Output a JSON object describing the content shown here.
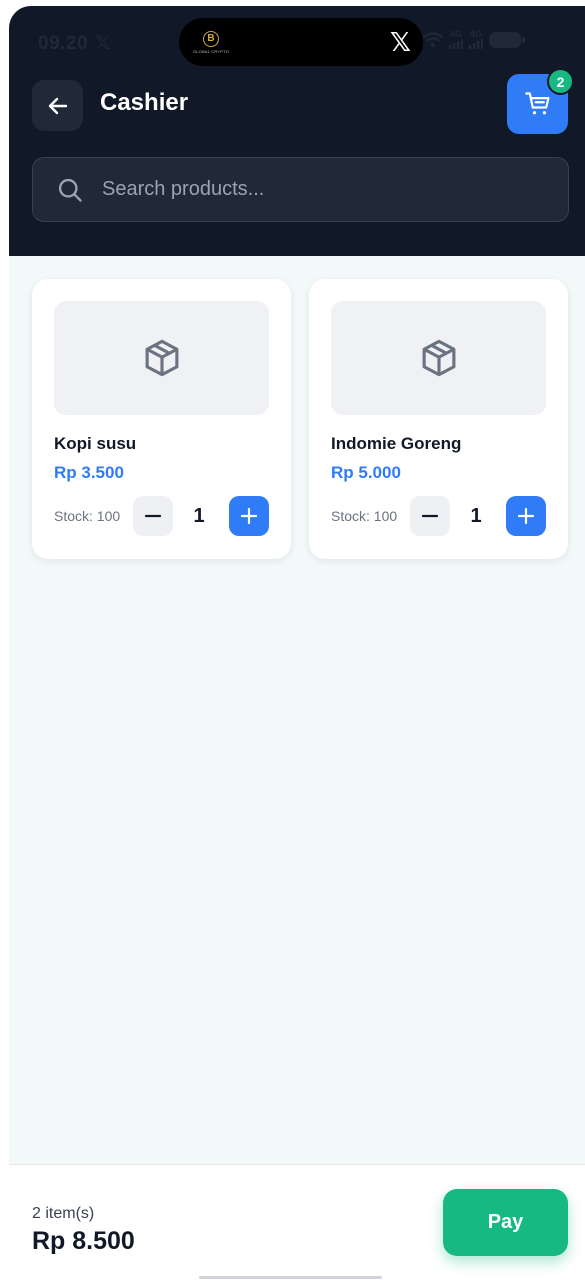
{
  "status_bar": {
    "time": "09.20",
    "x_glyph": "𝕏",
    "island_app_text": "GLOBAL CRYPTO",
    "island_coin_letter": "B",
    "island_x_glyph": "𝕏",
    "network_label_1": "4G",
    "network_label_2": "4G"
  },
  "header": {
    "title": "Cashier",
    "cart_count": "2"
  },
  "search": {
    "placeholder": "Search products...",
    "value": ""
  },
  "products": [
    {
      "name": "Kopi susu",
      "price": "Rp 3.500",
      "stock": "Stock: 100",
      "quantity": "1"
    },
    {
      "name": "Indomie Goreng",
      "price": "Rp 5.000",
      "stock": "Stock: 100",
      "quantity": "1"
    }
  ],
  "footer": {
    "items_count": "2 item(s)",
    "total": "Rp 8.500",
    "pay_label": "Pay"
  },
  "colors": {
    "header_bg": "#111827",
    "accent_blue": "#2f7cf6",
    "accent_green": "#16b981",
    "page_bg": "#f3f8f9"
  },
  "icons": {
    "back": "arrow-left-icon",
    "cart": "shopping-cart-icon",
    "search": "search-icon",
    "product_placeholder": "package-icon",
    "minus": "minus-icon",
    "plus": "plus-icon"
  }
}
